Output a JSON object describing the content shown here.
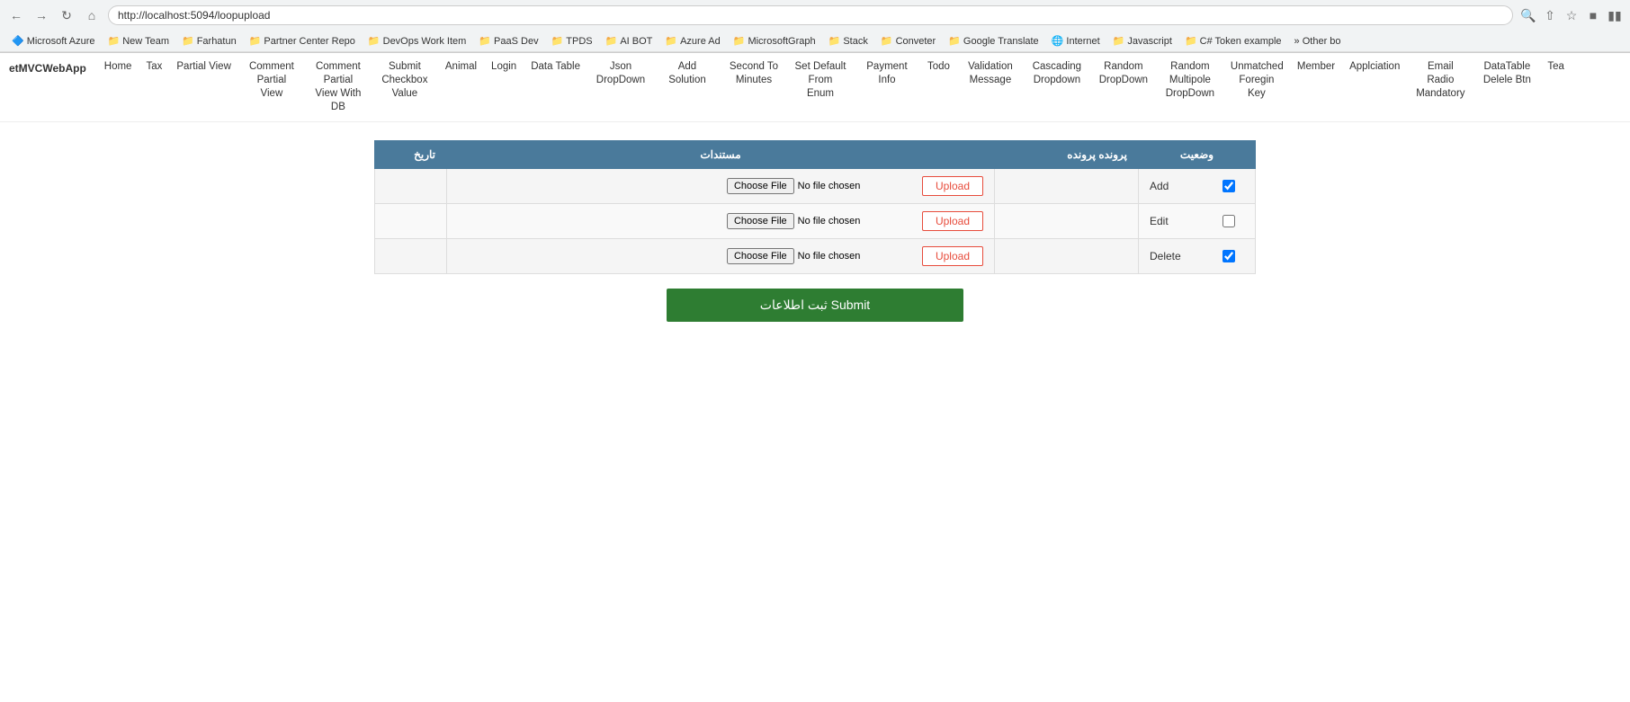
{
  "browser": {
    "url": "http://localhost:5094/loopupload",
    "back": "←",
    "forward": "→",
    "refresh": "↻",
    "home": "⌂"
  },
  "bookmarks": [
    {
      "label": "Microsoft Azure",
      "icon": "🔷"
    },
    {
      "label": "New Team",
      "icon": "📁"
    },
    {
      "label": "Farhatun",
      "icon": "📁"
    },
    {
      "label": "Partner Center Repo",
      "icon": "📁"
    },
    {
      "label": "DevOps Work Item",
      "icon": "📁"
    },
    {
      "label": "PaaS Dev",
      "icon": "📁"
    },
    {
      "label": "TPDS",
      "icon": "📁"
    },
    {
      "label": "AI BOT",
      "icon": "📁"
    },
    {
      "label": "Azure Ad",
      "icon": "📁"
    },
    {
      "label": "MicrosoftGraph",
      "icon": "📁"
    },
    {
      "label": "Stack",
      "icon": "📁"
    },
    {
      "label": "Conveter",
      "icon": "📁"
    },
    {
      "label": "Google Translate",
      "icon": "📁"
    },
    {
      "label": "Internet",
      "icon": "🌐"
    },
    {
      "label": "Javascript",
      "icon": "📁"
    },
    {
      "label": "C# Token example",
      "icon": "📁"
    },
    {
      "label": "» Other bo",
      "icon": ""
    }
  ],
  "app": {
    "brand": "etMVCWebApp"
  },
  "nav": {
    "items": [
      {
        "label": "Home",
        "multiline": false
      },
      {
        "label": "Tax",
        "multiline": false
      },
      {
        "label": "Partial View",
        "multiline": false
      },
      {
        "label": "Comment Partial View",
        "multiline": true
      },
      {
        "label": "Comment Partial View With DB",
        "multiline": true
      },
      {
        "label": "Submit Checkbox Value",
        "multiline": true
      },
      {
        "label": "Animal",
        "multiline": false
      },
      {
        "label": "Login",
        "multiline": false
      },
      {
        "label": "Data Table",
        "multiline": true
      },
      {
        "label": "Json DropDown",
        "multiline": true
      },
      {
        "label": "Add Solution",
        "multiline": true
      },
      {
        "label": "Second To Minutes",
        "multiline": true
      },
      {
        "label": "Set Default From Enum",
        "multiline": true
      },
      {
        "label": "Payment Info",
        "multiline": true
      },
      {
        "label": "Todo",
        "multiline": false
      },
      {
        "label": "Validation Message",
        "multiline": true
      },
      {
        "label": "Cascading Dropdown",
        "multiline": true
      },
      {
        "label": "Random DropDown",
        "multiline": true
      },
      {
        "label": "Random Multipole DropDown",
        "multiline": true
      },
      {
        "label": "Unmatched Foregin Key",
        "multiline": true
      },
      {
        "label": "Member",
        "multiline": false
      },
      {
        "label": "Applciation",
        "multiline": false
      },
      {
        "label": "Email Radio Mandatory",
        "multiline": true
      },
      {
        "label": "DataTable Delele Btn",
        "multiline": true
      },
      {
        "label": "Tea",
        "multiline": false
      }
    ]
  },
  "table": {
    "headers": {
      "tarik": "تاریخ",
      "mostanad": "مستندات",
      "parvande": "پرونده پرونده",
      "vaziat": "وضعیت"
    },
    "rows": [
      {
        "status_label": "Add",
        "checked": true
      },
      {
        "status_label": "Edit",
        "checked": false
      },
      {
        "status_label": "Delete",
        "checked": true
      }
    ],
    "upload_btn_label": "Upload",
    "file_input_placeholder": "No file chosen",
    "choose_file_label": "Choose File"
  },
  "submit": {
    "label": "ثبت اطلاعات Submit"
  }
}
